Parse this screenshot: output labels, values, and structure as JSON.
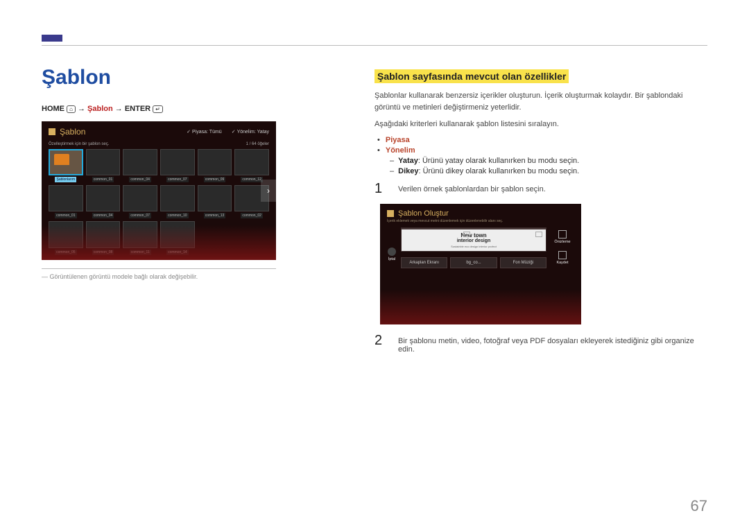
{
  "page_number": "67",
  "left": {
    "title": "Şablon",
    "breadcrumb": {
      "home": "HOME",
      "arrow": "→",
      "mid": "Şablon",
      "end": "ENTER",
      "home_glyph": "⌂",
      "enter_glyph": "↵"
    },
    "caption_prefix": "―",
    "caption": "Görüntülenen görüntü modele bağlı olarak değişebilir."
  },
  "ss1": {
    "title": "Şablon",
    "filter1": "Piyasa: Tümü",
    "filter2": "Yönelim: Yatay",
    "sub_left": "Özelleştirmek için bir şablon seç.",
    "count": "1 / 64 öğeler",
    "sel_label": "Şablonlarım",
    "items": [
      "common_01",
      "common_04",
      "common_07",
      "common_09",
      "common_12",
      "common_01",
      "common_04",
      "common_07",
      "common_10",
      "common_13",
      "common_02",
      "common_05",
      "common_08",
      "common_11",
      "common_14"
    ],
    "nav_glyph": "›"
  },
  "right": {
    "h2": "Şablon sayfasında mevcut olan özellikler",
    "p1": "Şablonlar kullanarak benzersiz içerikler oluşturun. İçerik oluşturmak kolaydır. Bir şablondaki görüntü ve metinleri değiştirmeniz yeterlidir.",
    "p2": "Aşağıdaki kriterleri kullanarak şablon listesini sıralayın.",
    "b_piyasa": "Piyasa",
    "b_yonelim": "Yönelim",
    "b_yatay_k": "Yatay",
    "b_yatay_v": ": Ürünü yatay olarak kullanırken bu modu seçin.",
    "b_dikey_k": "Dikey",
    "b_dikey_v": ": Ürünü dikey olarak kullanırken bu modu seçin.",
    "step1_num": "1",
    "step1": "Verilen örnek şablonlardan bir şablon seçin.",
    "step2_num": "2",
    "step2": "Bir şablonu metin, video, fotoğraf veya PDF dosyaları ekleyerek istediğiniz gibi organize edin."
  },
  "ss2": {
    "title": "Şablon Oluştur",
    "sub": "İçerik eklemek veya mevcut metni düzenlemek için düzenlenebilir alanı seç.",
    "left_btn": "İptal",
    "cap1": "New town",
    "cap2": "interior design",
    "cap3": "Sustainble eco design interior profect",
    "tab1": "Arkaplan Ekranı",
    "tab2": "bg_co...",
    "tab3": "Fon Müziği",
    "r1": "Önizleme",
    "r2": "Kaydet"
  }
}
